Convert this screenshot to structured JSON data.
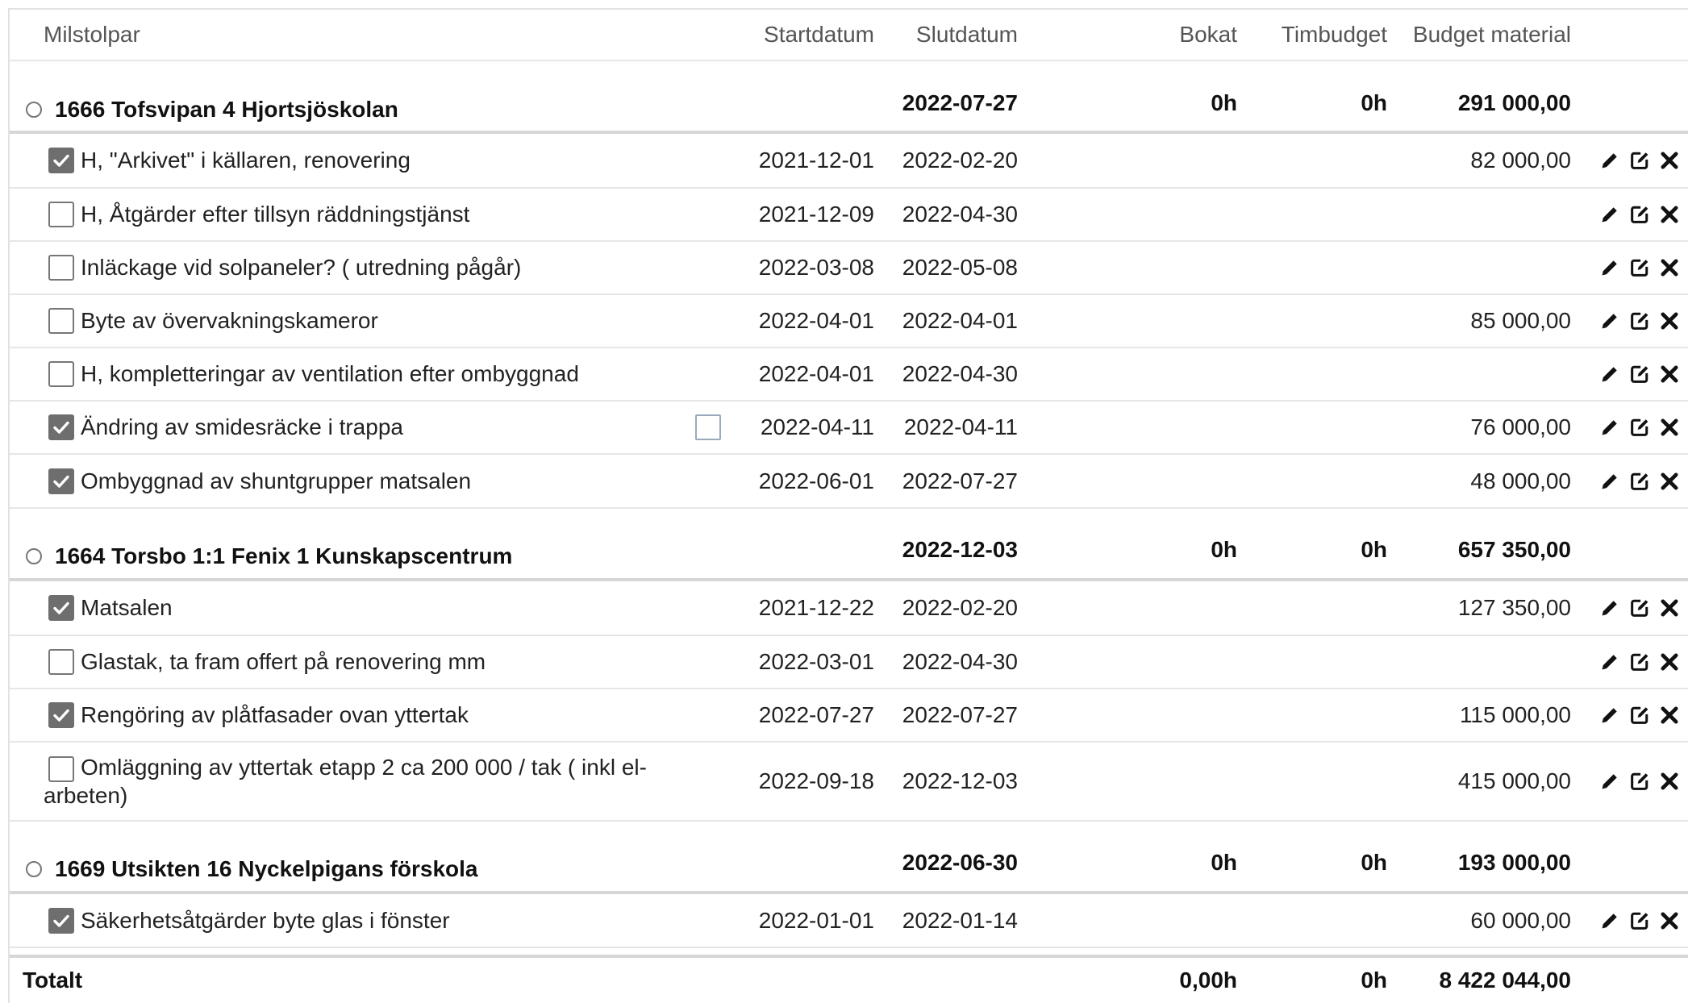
{
  "columns": {
    "milestone": "Milstolpar",
    "start": "Startdatum",
    "end": "Slutdatum",
    "booked": "Bokat",
    "hour_budget": "Timbudget",
    "material_budget": "Budget material"
  },
  "groups": [
    {
      "title": "1666 Tofsvipan 4 Hjortsjöskolan",
      "end": "2022-07-27",
      "booked": "0h",
      "hour_budget": "0h",
      "material_budget": "291 000,00",
      "tasks": [
        {
          "name": "H, \"Arkivet\" i källaren, renovering",
          "done": true,
          "start": "2021-12-01",
          "end": "2022-02-20",
          "end_overdue": false,
          "material_budget": "82 000,00"
        },
        {
          "name": "H, Åtgärder efter tillsyn räddningstjänst",
          "done": false,
          "start": "2021-12-09",
          "end": "2022-04-30",
          "end_overdue": true,
          "material_budget": ""
        },
        {
          "name": "Inläckage vid solpaneler? ( utredning pågår)",
          "done": false,
          "start": "2022-03-08",
          "end": "2022-05-08",
          "end_overdue": true,
          "material_budget": ""
        },
        {
          "name": "Byte av övervakningskameror",
          "done": false,
          "start": "2022-04-01",
          "end": "2022-04-01",
          "end_overdue": true,
          "material_budget": "85 000,00"
        },
        {
          "name": "H, kompletteringar av ventilation efter ombyggnad",
          "done": false,
          "start": "2022-04-01",
          "end": "2022-04-30",
          "end_overdue": true,
          "material_budget": ""
        },
        {
          "name": "Ändring av smidesräcke i trappa",
          "done": true,
          "start": "2022-04-11",
          "end": "2022-04-11",
          "end_overdue": false,
          "material_budget": "76 000,00",
          "extra_checkbox": true
        },
        {
          "name": "Ombyggnad av shuntgrupper matsalen",
          "done": true,
          "start": "2022-06-01",
          "end": "2022-07-27",
          "end_overdue": false,
          "material_budget": "48 000,00"
        }
      ]
    },
    {
      "title": "1664 Torsbo 1:1 Fenix 1 Kunskapscentrum",
      "end": "2022-12-03",
      "booked": "0h",
      "hour_budget": "0h",
      "material_budget": "657 350,00",
      "tasks": [
        {
          "name": "Matsalen",
          "done": true,
          "start": "2021-12-22",
          "end": "2022-02-20",
          "end_overdue": false,
          "material_budget": "127 350,00"
        },
        {
          "name": "Glastak, ta fram offert på renovering mm",
          "done": false,
          "start": "2022-03-01",
          "end": "2022-04-30",
          "end_overdue": true,
          "material_budget": ""
        },
        {
          "name": "Rengöring av plåtfasader ovan yttertak",
          "done": true,
          "start": "2022-07-27",
          "end": "2022-07-27",
          "end_overdue": false,
          "material_budget": "115 000,00"
        },
        {
          "name": "Omläggning av yttertak etapp 2 ca 200 000 / tak ( inkl el-arbeten)",
          "done": false,
          "start": "2022-09-18",
          "end": "2022-12-03",
          "end_overdue": false,
          "material_budget": "415 000,00"
        }
      ]
    },
    {
      "title": "1669 Utsikten 16 Nyckelpigans förskola",
      "end": "2022-06-30",
      "booked": "0h",
      "hour_budget": "0h",
      "material_budget": "193 000,00",
      "tasks": [
        {
          "name": "Säkerhetsåtgärder byte glas i fönster",
          "done": true,
          "start": "2022-01-01",
          "end": "2022-01-14",
          "end_overdue": false,
          "material_budget": "60 000,00"
        }
      ]
    }
  ],
  "total": {
    "label": "Totalt",
    "booked": "0,00h",
    "hour_budget": "0h",
    "material_budget": "8 422 044,00"
  },
  "colors": {
    "overdue": "#e01010",
    "checkbox_checked": "#6e6e6e",
    "border": "#e6e6e6"
  },
  "icons": {
    "row_actions": [
      "pencil-icon",
      "edit-square-icon",
      "delete-x-icon"
    ]
  }
}
